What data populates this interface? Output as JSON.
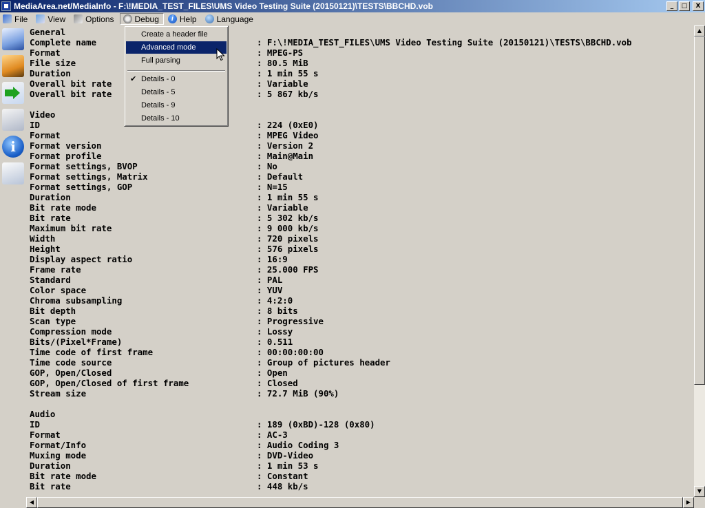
{
  "window": {
    "title": "MediaArea.net/MediaInfo - F:\\!MEDIA_TEST_FILES\\UMS Video Testing Suite (20150121)\\TESTS\\BBCHD.vob",
    "buttons": {
      "minimize": "_",
      "maximize": "□",
      "close": "X"
    }
  },
  "menu": {
    "file": "File",
    "view": "View",
    "options": "Options",
    "debug": "Debug",
    "help": "Help",
    "language": "Language"
  },
  "dropdown": {
    "items": [
      "Create a header file",
      "Advanced mode",
      "Full parsing",
      "Details - 0",
      "Details - 5",
      "Details - 9",
      "Details - 10"
    ],
    "check": "✔"
  },
  "general": {
    "heading": "General",
    "rows": [
      {
        "k": "Complete name",
        "v": ": F:\\!MEDIA_TEST_FILES\\UMS Video Testing Suite (20150121)\\TESTS\\BBCHD.vob"
      },
      {
        "k": "Format",
        "v": ": MPEG-PS"
      },
      {
        "k": "File size",
        "v": ": 80.5 MiB"
      },
      {
        "k": "Duration",
        "v": ": 1 min 55 s"
      },
      {
        "k": "Overall bit rate",
        "v": ": Variable"
      },
      {
        "k": "Overall bit rate",
        "v": ": 5 867 kb/s"
      }
    ]
  },
  "video": {
    "heading": "Video",
    "rows": [
      {
        "k": "ID",
        "v": ": 224 (0xE0)"
      },
      {
        "k": "Format",
        "v": ": MPEG Video"
      },
      {
        "k": "Format version",
        "v": ": Version 2"
      },
      {
        "k": "Format profile",
        "v": ": Main@Main"
      },
      {
        "k": "Format settings, BVOP",
        "v": ": No"
      },
      {
        "k": "Format settings, Matrix",
        "v": ": Default"
      },
      {
        "k": "Format settings, GOP",
        "v": ": N=15"
      },
      {
        "k": "Duration",
        "v": ": 1 min 55 s"
      },
      {
        "k": "Bit rate mode",
        "v": ": Variable"
      },
      {
        "k": "Bit rate",
        "v": ": 5 302 kb/s"
      },
      {
        "k": "Maximum bit rate",
        "v": ": 9 000 kb/s"
      },
      {
        "k": "Width",
        "v": ": 720 pixels"
      },
      {
        "k": "Height",
        "v": ": 576 pixels"
      },
      {
        "k": "Display aspect ratio",
        "v": ": 16:9"
      },
      {
        "k": "Frame rate",
        "v": ": 25.000 FPS"
      },
      {
        "k": "Standard",
        "v": ": PAL"
      },
      {
        "k": "Color space",
        "v": ": YUV"
      },
      {
        "k": "Chroma subsampling",
        "v": ": 4:2:0"
      },
      {
        "k": "Bit depth",
        "v": ": 8 bits"
      },
      {
        "k": "Scan type",
        "v": ": Progressive"
      },
      {
        "k": "Compression mode",
        "v": ": Lossy"
      },
      {
        "k": "Bits/(Pixel*Frame)",
        "v": ": 0.511"
      },
      {
        "k": "Time code of first frame",
        "v": ": 00:00:00:00"
      },
      {
        "k": "Time code source",
        "v": ": Group of pictures header"
      },
      {
        "k": "GOP, Open/Closed",
        "v": ": Open"
      },
      {
        "k": "GOP, Open/Closed of first frame",
        "v": ": Closed"
      },
      {
        "k": "Stream size",
        "v": ": 72.7 MiB (90%)"
      }
    ]
  },
  "audio": {
    "heading": "Audio",
    "rows": [
      {
        "k": "ID",
        "v": ": 189 (0xBD)-128 (0x80)"
      },
      {
        "k": "Format",
        "v": ": AC-3"
      },
      {
        "k": "Format/Info",
        "v": ": Audio Coding 3"
      },
      {
        "k": "Muxing mode",
        "v": ": DVD-Video"
      },
      {
        "k": "Duration",
        "v": ": 1 min 53 s"
      },
      {
        "k": "Bit rate mode",
        "v": ": Constant"
      },
      {
        "k": "Bit rate",
        "v": ": 448 kb/s"
      }
    ]
  }
}
